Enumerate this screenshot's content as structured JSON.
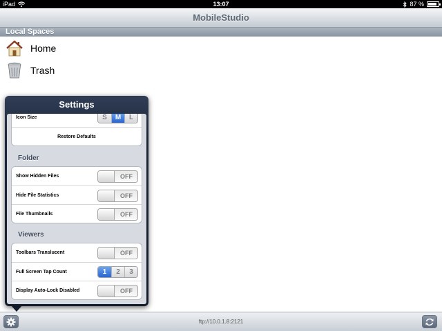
{
  "status_bar": {
    "carrier": "iPad",
    "time": "13:07",
    "battery": "87 %",
    "battery_level": 0.87
  },
  "nav_bar": {
    "title": "MobileStudio"
  },
  "local_spaces": {
    "header": "Local Spaces",
    "items": [
      {
        "label": "Home",
        "icon": "house-icon"
      },
      {
        "label": "Trash",
        "icon": "trash-can-icon"
      }
    ]
  },
  "settings": {
    "title": "Settings",
    "general": {
      "icon_size_label": "Icon Size",
      "icon_size_options": [
        "S",
        "M",
        "L"
      ],
      "icon_size_selected": "M",
      "restore_defaults": "Restore Defaults"
    },
    "folder": {
      "title": "Folder",
      "rows": [
        {
          "label": "Show Hidden Files",
          "value": "OFF"
        },
        {
          "label": "Hide File Statistics",
          "value": "OFF"
        },
        {
          "label": "File Thumbnails",
          "value": "OFF"
        }
      ]
    },
    "viewers": {
      "title": "Viewers",
      "toolbars_translucent": {
        "label": "Toolbars Translucent",
        "value": "OFF"
      },
      "tap_count": {
        "label": "Full Screen Tap Count",
        "options": [
          "1",
          "2",
          "3"
        ],
        "selected": "1"
      },
      "auto_lock": {
        "label": "Display Auto-Lock Disabled",
        "value": "OFF"
      }
    }
  },
  "toolbar": {
    "url": "ftp://10.0.1.8:2121",
    "settings_icon": "gear-icon",
    "refresh_icon": "refresh-icon"
  },
  "colors": {
    "popover": "#1c2639",
    "selected_segment": "#2966d2",
    "section_header": "#8995a2"
  }
}
